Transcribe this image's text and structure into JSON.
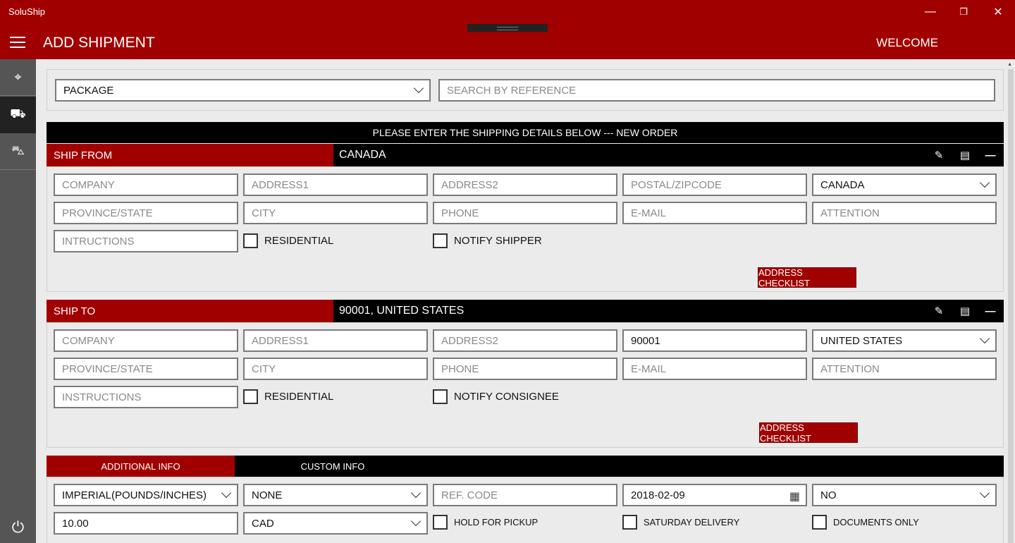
{
  "window": {
    "app_title": "SoluShip",
    "minimize": "—",
    "restore": "❐",
    "close": "✕"
  },
  "header": {
    "title": "ADD SHIPMENT",
    "welcome": "WELCOME"
  },
  "sidebar": {
    "items": [
      {
        "icon": "map-pin-icon",
        "glyph": "⌖"
      },
      {
        "icon": "package-add-icon",
        "glyph": "⛟"
      },
      {
        "icon": "truck-icon",
        "glyph": "⛍"
      }
    ],
    "power_glyph": "⏻"
  },
  "top": {
    "package_type": "PACKAGE",
    "search_placeholder": "SEARCH BY REFERENCE"
  },
  "banner": "PLEASE ENTER THE SHIPPING DETAILS BELOW --- NEW ORDER",
  "ship_from": {
    "label": "SHIP FROM",
    "summary": "CANADA",
    "company": "COMPANY",
    "address1": "ADDRESS1",
    "address2": "ADDRESS2",
    "postal": "POSTAL/ZIPCODE",
    "country": "CANADA",
    "province": "PROVINCE/STATE",
    "city": "CITY",
    "phone": "PHONE",
    "email": "E-MAIL",
    "attention": "ATTENTION",
    "instructions": "INTRUCTIONS",
    "residential": "RESIDENTIAL",
    "notify": "NOTIFY SHIPPER",
    "checklist": "ADDRESS CHECKLIST"
  },
  "ship_to": {
    "label": "SHIP TO",
    "summary": "90001, UNITED STATES",
    "company": "COMPANY",
    "address1": "ADDRESS1",
    "address2": "ADDRESS2",
    "postal": "90001",
    "country": "UNITED STATES",
    "province": "PROVINCE/STATE",
    "city": "CITY",
    "phone": "PHONE",
    "email": "E-MAIL",
    "attention": "ATTENTION",
    "instructions": "INSTRUCTIONS",
    "residential": "RESIDENTIAL",
    "notify": "NOTIFY CONSIGNEE",
    "checklist": "ADDRESS CHECKLIST"
  },
  "tabs": {
    "additional": "ADDITIONAL INFO",
    "custom": "CUSTOM INFO"
  },
  "additional": {
    "units": "IMPERIAL(POUNDS/INCHES)",
    "option": "NONE",
    "ref_code": "REF. CODE",
    "date": "2018-02-09",
    "yes_no": "NO",
    "amount": "10.00",
    "currency": "CAD",
    "hold": "HOLD FOR PICKUP",
    "saturday": "SATURDAY DELIVERY",
    "documents": "DOCUMENTS ONLY"
  },
  "icons": {
    "edit": "✎",
    "contact": "▤",
    "collapse": "—",
    "calendar": "▦"
  }
}
